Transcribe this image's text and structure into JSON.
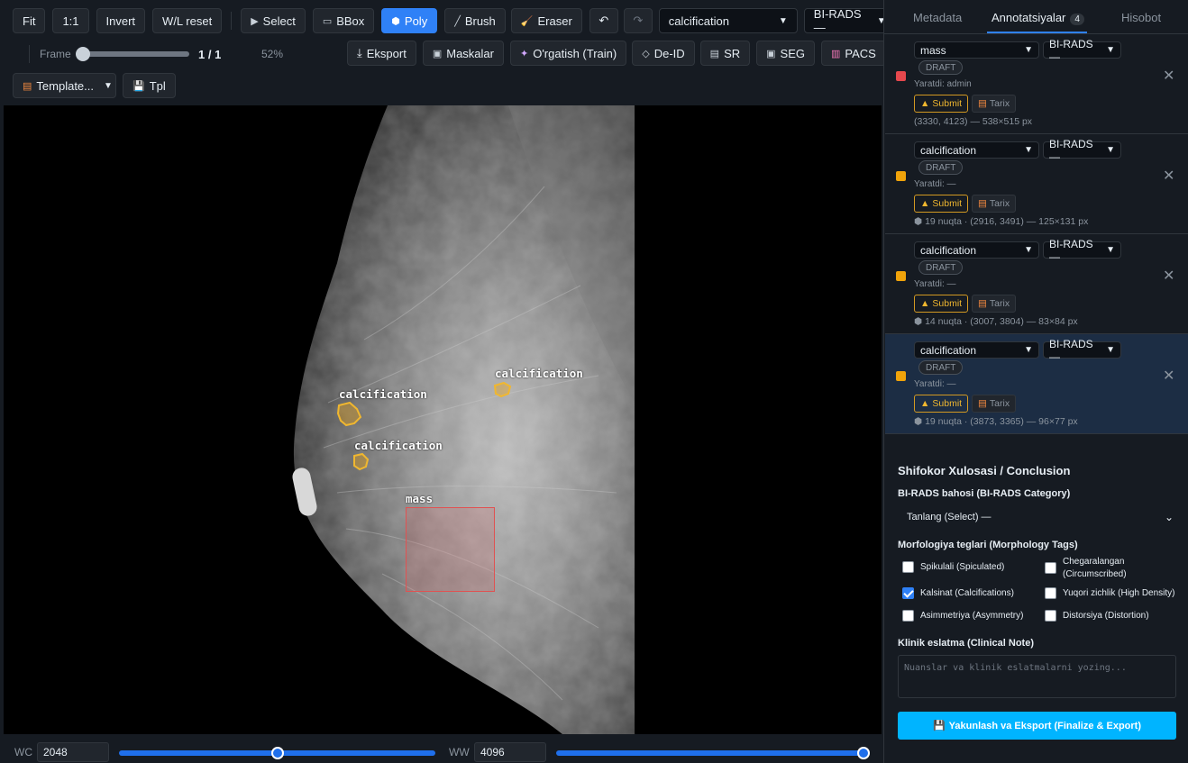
{
  "toolbar": {
    "fit": "Fit",
    "one_to_one": "1:1",
    "invert": "Invert",
    "wl_reset": "W/L reset",
    "tools": {
      "select": "Select",
      "bbox": "BBox",
      "poly": "Poly",
      "brush": "Brush",
      "eraser": "Eraser"
    },
    "active_tool": "Poly",
    "label_select": "calcification",
    "birads_select": "BI-RADS —",
    "frame_label": "Frame",
    "frame_value": "1 / 1",
    "frame_progress": 0,
    "zoom": "52%",
    "export": "Eksport",
    "masks": "Maskalar",
    "train": "O'rgatish (Train)",
    "deid": "De-ID",
    "sr": "SR",
    "seg": "SEG",
    "pacs": "PACS",
    "template": "Template...",
    "tpl": "Tpl"
  },
  "viewer": {
    "annotations": [
      {
        "label": "calcification"
      },
      {
        "label": "calcification"
      },
      {
        "label": "calcification"
      },
      {
        "label": "mass"
      }
    ]
  },
  "windowing": {
    "wc_label": "WC",
    "wc_value": "2048",
    "wc_fraction": 0.5,
    "ww_label": "WW",
    "ww_value": "4096",
    "ww_fraction": 1.0
  },
  "panel": {
    "tabs": [
      "Metadata",
      "Annotatsiyalar",
      "Hisobot"
    ],
    "active_tab": "Annotatsiyalar",
    "annotation_count": "4",
    "annotations": [
      {
        "label": "mass",
        "birads": "BI-RADS —",
        "status": "DRAFT",
        "creator": "Yaratdi: admin",
        "submit": "Submit",
        "history": "Tarix",
        "meta": "(3330, 4123) — 538×515 px",
        "color": "#e5484d",
        "selected": false
      },
      {
        "label": "calcification",
        "birads": "BI-RADS —",
        "status": "DRAFT",
        "creator": "Yaratdi: —",
        "submit": "Submit",
        "history": "Tarix",
        "meta": "⬢ 19 nuqta · (2916, 3491) — 125×131 px",
        "color": "#f0a30a",
        "selected": false
      },
      {
        "label": "calcification",
        "birads": "BI-RADS —",
        "status": "DRAFT",
        "creator": "Yaratdi: —",
        "submit": "Submit",
        "history": "Tarix",
        "meta": "⬢ 14 nuqta · (3007, 3804) — 83×84 px",
        "color": "#f0a30a",
        "selected": false
      },
      {
        "label": "calcification",
        "birads": "BI-RADS —",
        "status": "DRAFT",
        "creator": "Yaratdi: —",
        "submit": "Submit",
        "history": "Tarix",
        "meta": "⬢ 19 nuqta · (3873, 3365) — 96×77 px",
        "color": "#f0a30a",
        "selected": true
      }
    ],
    "conclusion": {
      "title": "Shifokor Xulosasi / Conclusion",
      "birads_label": "BI-RADS bahosi (BI-RADS Category)",
      "birads_value": "Tanlang (Select) —",
      "morph_label": "Morfologiya teglari (Morphology Tags)",
      "tags": [
        {
          "label": "Spikulali (Spiculated)",
          "checked": false
        },
        {
          "label": "Chegaralangan (Circumscribed)",
          "checked": false
        },
        {
          "label": "Kalsinat (Calcifications)",
          "checked": true
        },
        {
          "label": "Yuqori zichlik (High Density)",
          "checked": false
        },
        {
          "label": "Asimmetriya (Asymmetry)",
          "checked": false
        },
        {
          "label": "Distorsiya (Distortion)",
          "checked": false
        }
      ],
      "note_label": "Klinik eslatma (Clinical Note)",
      "note_placeholder": "Nuanslar va klinik eslatmalarni yozing...",
      "finalize": "Yakunlash va Eksport (Finalize & Export)"
    }
  }
}
